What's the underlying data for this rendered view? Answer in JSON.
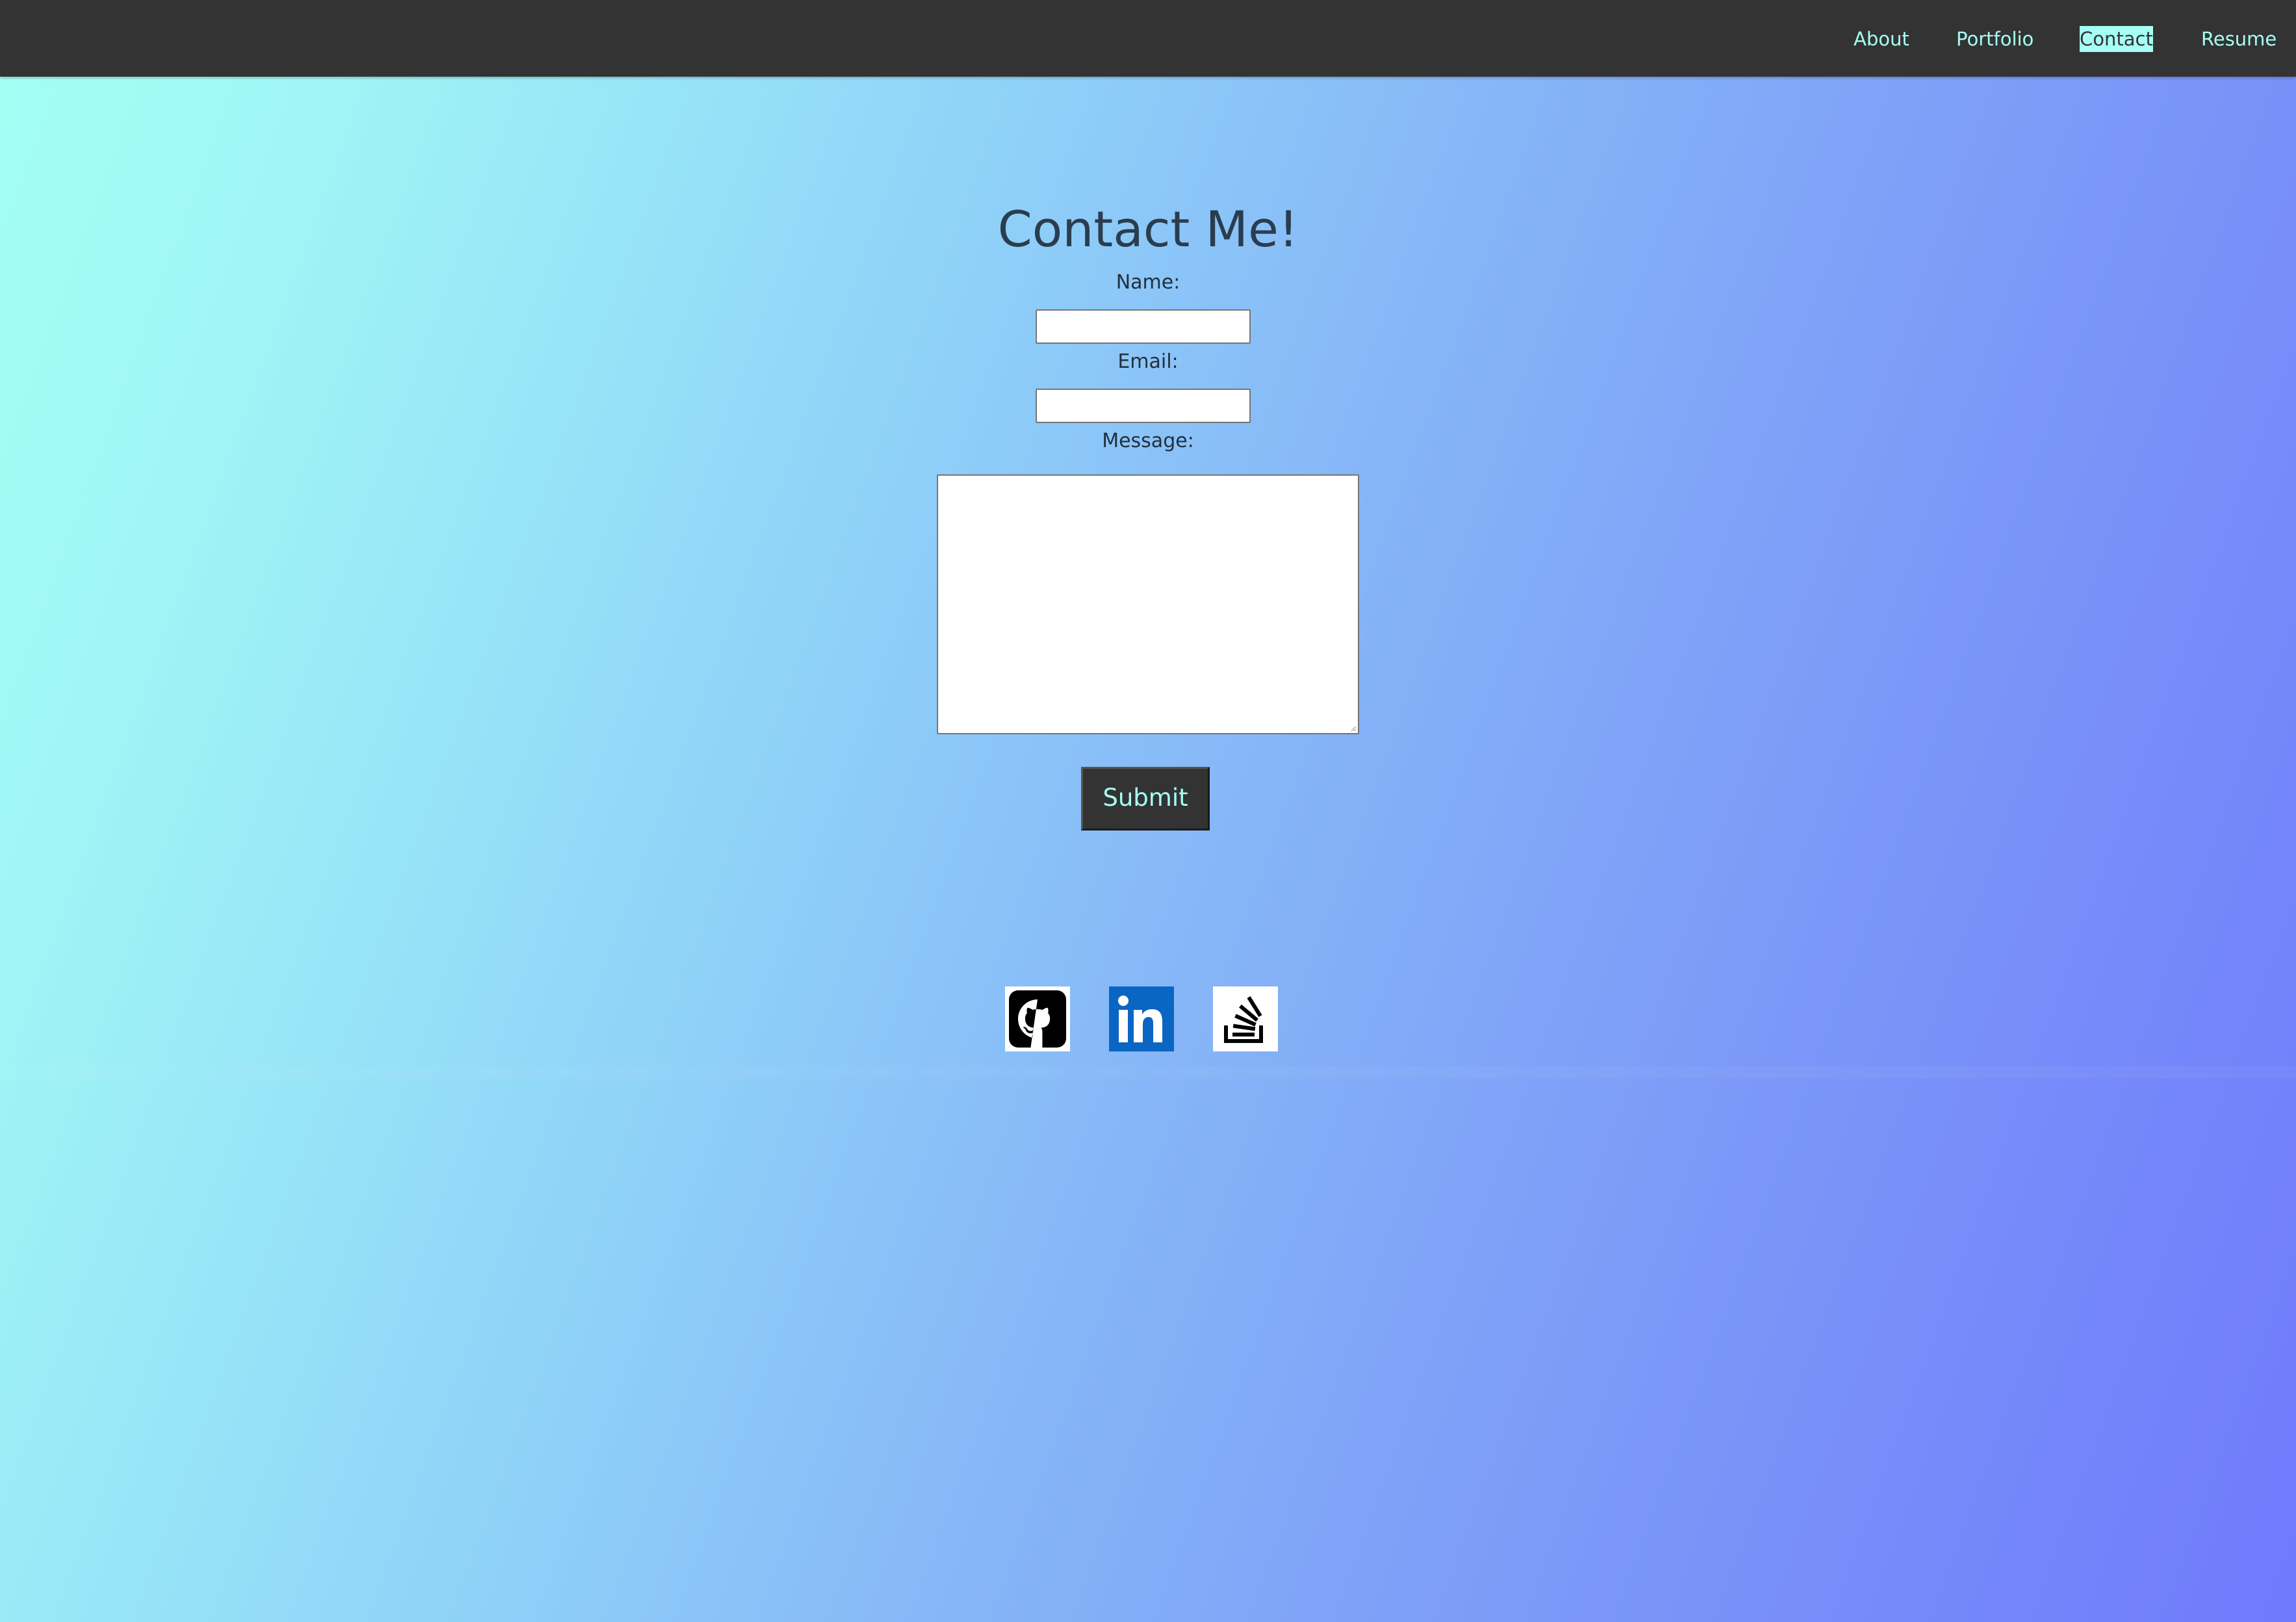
{
  "nav": {
    "items": [
      {
        "label": "About"
      },
      {
        "label": "Portfolio"
      },
      {
        "label": "Contact"
      },
      {
        "label": "Resume"
      }
    ]
  },
  "contact": {
    "title": "Contact Me!",
    "name_label": "Name:",
    "name_value": "",
    "email_label": "Email:",
    "email_value": "",
    "message_label": "Message:",
    "message_value": "",
    "submit_label": "Submit"
  },
  "social": {
    "links": [
      {
        "icon": "github-icon"
      },
      {
        "icon": "linkedin-icon"
      },
      {
        "icon": "stackoverflow-icon"
      }
    ]
  },
  "colors": {
    "navbar": "#333333",
    "accent": "#a6fff4",
    "title": "#2a3d4f",
    "gradient_start": "#a3fff3",
    "gradient_end": "#6f7afc",
    "linkedin": "#0a66c2"
  }
}
